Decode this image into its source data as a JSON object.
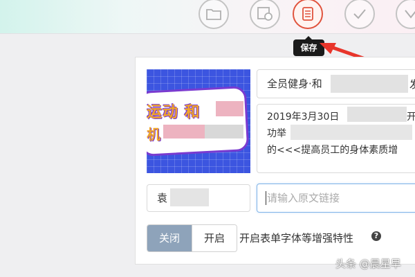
{
  "toolbar": {
    "buttons": [
      {
        "icon": "folder-icon"
      },
      {
        "icon": "image-gear-icon"
      },
      {
        "icon": "save-doc-icon",
        "active": true
      },
      {
        "icon": "checkmark-icon"
      },
      {
        "icon": "chevron-down-icon"
      }
    ],
    "save_tooltip": "保存"
  },
  "form": {
    "title_value": "全员健身·和",
    "title_trailing": "发",
    "summary_lines": [
      "2019年3月30日",
      "功举",
      "的<<<提高员工的身体素质增"
    ],
    "summary_trailing": "开",
    "author_value": "袁",
    "link_placeholder": "请输入原文链接",
    "toggle_close": "关闭",
    "toggle_open": "开启",
    "toggle_label": "开启表单字体等增强特性",
    "help_glyph": "?"
  },
  "cover": {
    "line1": "运动 和",
    "line2": "机"
  },
  "watermark": "头条 @晨星早",
  "colors": {
    "accent": "#e0533d",
    "toggle_active": "#8ea3ba",
    "cover_bg": "#3c55e0"
  }
}
